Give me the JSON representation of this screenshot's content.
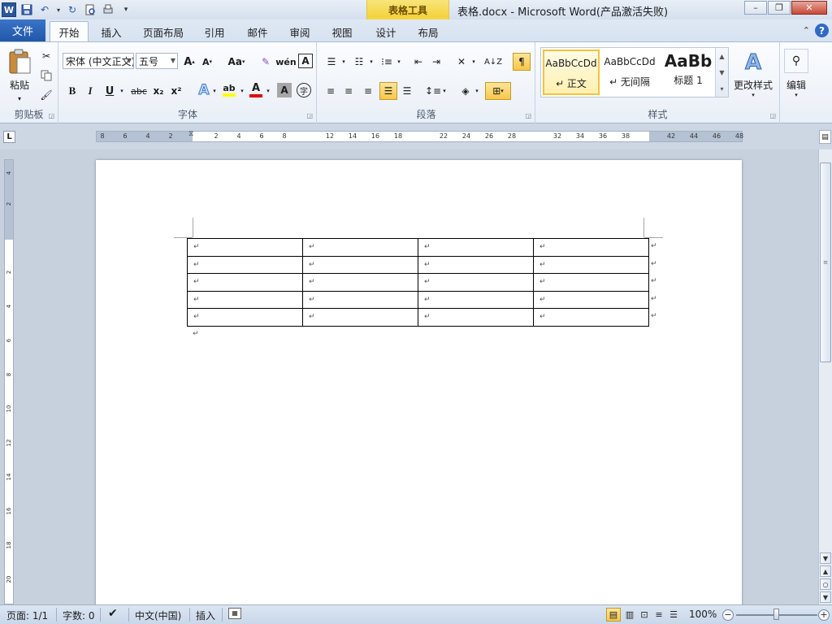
{
  "title": {
    "document": "表格.docx",
    "separator": "-",
    "app": "Microsoft Word(产品激活失败)"
  },
  "contextual_group": "表格工具",
  "tabs": {
    "file": "文件",
    "home": "开始",
    "insert": "插入",
    "layout": "页面布局",
    "references": "引用",
    "mailings": "邮件",
    "review": "审阅",
    "view": "视图",
    "design": "设计",
    "table_layout": "布局"
  },
  "ribbon": {
    "clipboard": {
      "paste": "粘贴",
      "label": "剪贴板"
    },
    "font": {
      "label": "字体",
      "font_name": "宋体 (中文正文)",
      "font_size": "五号",
      "grow": "A",
      "shrink": "A",
      "case": "Aa",
      "clear": "A",
      "bold": "B",
      "italic": "I",
      "underline": "U",
      "strike": "abc",
      "subscript": "x₂",
      "superscript": "x²",
      "effects": "A",
      "highlight": "ab",
      "color": "A",
      "shade": "A",
      "enclose": "字"
    },
    "paragraph": {
      "label": "段落"
    },
    "styles": {
      "label": "样式",
      "cards": [
        {
          "sample": "AaBbCcDd",
          "name": "↵ 正文"
        },
        {
          "sample": "AaBbCcDd",
          "name": "↵ 无间隔"
        },
        {
          "sample": "AaBb",
          "name": "标题 1"
        }
      ],
      "change_styles": "更改样式"
    },
    "editing": {
      "label": "编辑"
    }
  },
  "rulers": {
    "horizontal": [
      "8",
      "6",
      "4",
      "2",
      "2",
      "4",
      "6",
      "8",
      "12",
      "14",
      "16",
      "18",
      "22",
      "24",
      "26",
      "28",
      "32",
      "34",
      "36",
      "38",
      "42",
      "44",
      "46",
      "48"
    ],
    "vertical": [
      "4",
      "2",
      "2",
      "4",
      "6",
      "8",
      "10",
      "12",
      "14",
      "16",
      "18",
      "20"
    ]
  },
  "table": {
    "rows": 5,
    "cols": 4,
    "cell_mark": "↵",
    "end_mark": "↵"
  },
  "statusbar": {
    "page": "页面: 1/1",
    "words": "字数: 0",
    "language": "中文(中国)",
    "mode": "插入",
    "zoom": "100%",
    "zoom_percent": 100
  },
  "colors": {
    "file_tab": "#2b579a",
    "context_group": "#f5d33f",
    "highlight_btn": "#f9c748"
  }
}
